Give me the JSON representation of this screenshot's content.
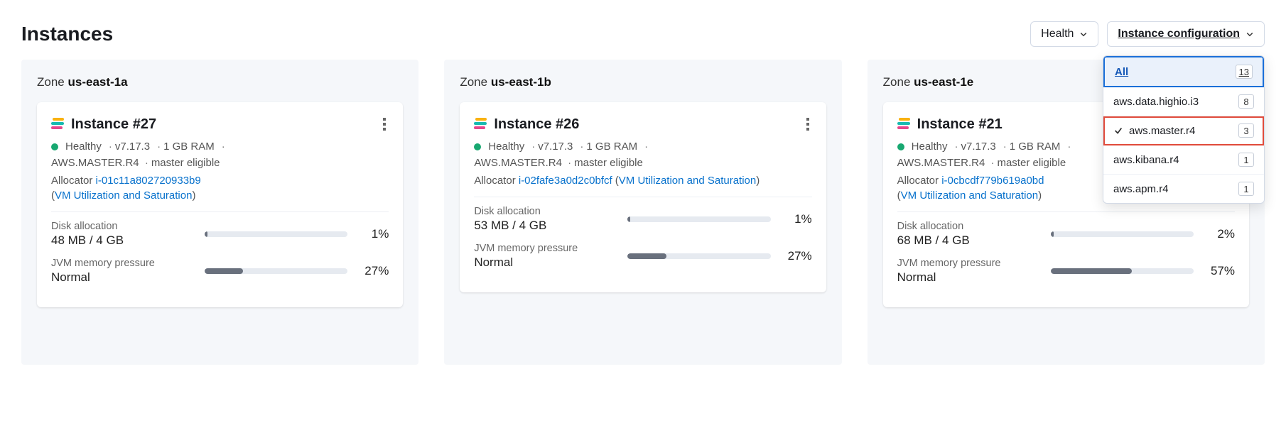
{
  "header": {
    "title": "Instances",
    "health_filter_label": "Health",
    "config_filter_label": "Instance configuration"
  },
  "dropdown": {
    "items": [
      {
        "label": "All",
        "count": "13",
        "style": "all"
      },
      {
        "label": "aws.data.highio.i3",
        "count": "8",
        "style": ""
      },
      {
        "label": "aws.master.r4",
        "count": "3",
        "style": "highlight"
      },
      {
        "label": "aws.kibana.r4",
        "count": "1",
        "style": ""
      },
      {
        "label": "aws.apm.r4",
        "count": "1",
        "style": ""
      }
    ]
  },
  "zones": [
    {
      "zone_prefix": "Zone",
      "zone_name": "us-east-1a",
      "card": {
        "name": "Instance #27",
        "health": "Healthy",
        "version": "v7.17.3",
        "ram": "1 GB RAM",
        "type": "AWS.MASTER.R4",
        "role": "master eligible",
        "allocator_label": "Allocator",
        "allocator_id": "i-01c11a802720933b9",
        "vm_link": "VM Utilization and Saturation",
        "disk": {
          "label": "Disk allocation",
          "value": "48 MB / 4 GB",
          "pct_label": "1%",
          "pct_fill": 1
        },
        "jvm": {
          "label": "JVM memory pressure",
          "value": "Normal",
          "pct_label": "27%",
          "pct_fill": 27
        }
      }
    },
    {
      "zone_prefix": "Zone",
      "zone_name": "us-east-1b",
      "card": {
        "name": "Instance #26",
        "health": "Healthy",
        "version": "v7.17.3",
        "ram": "1 GB RAM",
        "type": "AWS.MASTER.R4",
        "role": "master eligible",
        "allocator_label": "Allocator",
        "allocator_id": "i-02fafe3a0d2c0bfcf",
        "vm_link": "VM Utilization and Saturation",
        "vm_inline": true,
        "disk": {
          "label": "Disk allocation",
          "value": "53 MB / 4 GB",
          "pct_label": "1%",
          "pct_fill": 1
        },
        "jvm": {
          "label": "JVM memory pressure",
          "value": "Normal",
          "pct_label": "27%",
          "pct_fill": 27
        }
      }
    },
    {
      "zone_prefix": "Zone",
      "zone_name": "us-east-1e",
      "card": {
        "name": "Instance #21",
        "health": "Healthy",
        "version": "v7.17.3",
        "ram": "1 GB RAM",
        "type": "AWS.MASTER.R4",
        "role": "master eligible",
        "allocator_label": "Allocator",
        "allocator_id": "i-0cbcdf779b619a0bd",
        "vm_link": "VM Utilization and Saturation",
        "disk": {
          "label": "Disk allocation",
          "value": "68 MB / 4 GB",
          "pct_label": "2%",
          "pct_fill": 2
        },
        "jvm": {
          "label": "JVM memory pressure",
          "value": "Normal",
          "pct_label": "57%",
          "pct_fill": 57
        }
      }
    }
  ]
}
